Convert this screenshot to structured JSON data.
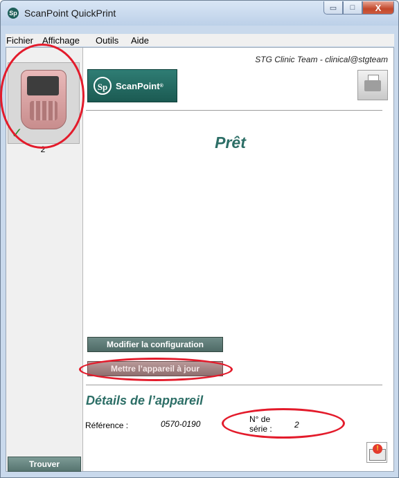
{
  "window": {
    "title": "ScanPoint QuickPrint",
    "app_icon": "Sp",
    "controls": {
      "minimize": "▭",
      "maximize": "□",
      "close": "X"
    }
  },
  "menubar": {
    "items": [
      "Fichier",
      "Affichage",
      "Outils",
      "Aide"
    ]
  },
  "sidebar": {
    "device": {
      "number": "2",
      "status_icon": "checkmark-icon",
      "check_glyph": "✓"
    },
    "find_button": "Trouver"
  },
  "header": {
    "user_line": "STG Clinic Team - clinical@stgteam",
    "logo_text": "ScanPoint",
    "logo_mark": "Sp",
    "logo_reg": "®"
  },
  "main": {
    "status": "Prêt",
    "buttons": {
      "modify_config": "Modifier la configuration",
      "update_device": "Mettre l’appareil à jour"
    },
    "details": {
      "title": "Détails de l’appareil",
      "reference_label": "Référence :",
      "reference_value": "0570-0190",
      "serial_label_line1": "N° de",
      "serial_label_line2": "série :",
      "serial_value": "2"
    }
  },
  "colors": {
    "accent_teal": "#2c6e66",
    "button_teal": "#56746f",
    "highlight_red": "#e31b2b"
  }
}
